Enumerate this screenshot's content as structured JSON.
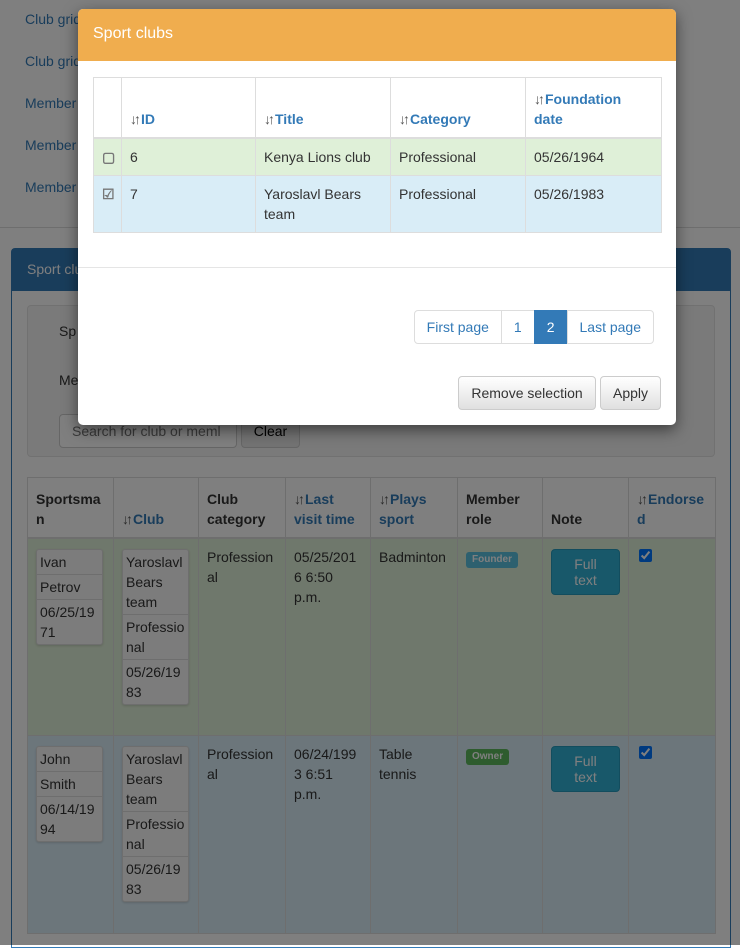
{
  "background": {
    "nav_links": [
      "Club grid",
      "Club grid",
      "Member",
      "Member",
      "Member"
    ],
    "panel_title": "Sport clu",
    "filter_labels": [
      "Sp",
      "Me"
    ],
    "search_placeholder": "Search for club or meml",
    "clear_label": "Clear",
    "grid": {
      "columns": [
        {
          "label": "Sportsman",
          "sortable": false
        },
        {
          "label": "Club",
          "sortable": true
        },
        {
          "label": "Club category",
          "sortable": false
        },
        {
          "label": "Last visit time",
          "sortable": true
        },
        {
          "label": "Plays sport",
          "sortable": true
        },
        {
          "label": "Member role",
          "sortable": false
        },
        {
          "label": "Note",
          "sortable": false
        },
        {
          "label": "Endorsed",
          "sortable": true
        }
      ],
      "rows": [
        {
          "first": "Ivan",
          "last": "Petrov",
          "birth": "06/25/1971",
          "club_title": "Yaroslavl Bears team",
          "club_category": "Professional",
          "club_date": "05/26/1983",
          "category": "Professional",
          "last_visit": "05/25/2016 6:50 p.m.",
          "sport": "Badminton",
          "role": "Founder",
          "role_color": "#5bc0de",
          "note_button": "Full text",
          "endorsed": true
        },
        {
          "first": "John",
          "last": "Smith",
          "birth": "06/14/1994",
          "club_title": "Yaroslavl Bears team",
          "club_category": "Professional",
          "club_date": "05/26/1983",
          "category": "Professional",
          "last_visit": "06/24/1993 6:51 p.m.",
          "sport": "Table tennis",
          "role": "Owner",
          "role_color": "#5cb85c",
          "note_button": "Full text",
          "endorsed": true
        }
      ]
    }
  },
  "modal": {
    "title": "Sport clubs",
    "header_color": "#f0ad4e",
    "columns": [
      "ID",
      "Title",
      "Category",
      "Foundation date"
    ],
    "rows": [
      {
        "selected": false,
        "id": "6",
        "title": "Kenya Lions club",
        "category": "Professional",
        "date": "05/26/1964"
      },
      {
        "selected": true,
        "id": "7",
        "title": "Yaroslavl Bears team",
        "category": "Professional",
        "date": "05/26/1983"
      }
    ],
    "pagination": {
      "first": "First page",
      "pages": [
        "1",
        "2"
      ],
      "current": "2",
      "last": "Last page"
    },
    "remove_label": "Remove selection",
    "apply_label": "Apply"
  }
}
